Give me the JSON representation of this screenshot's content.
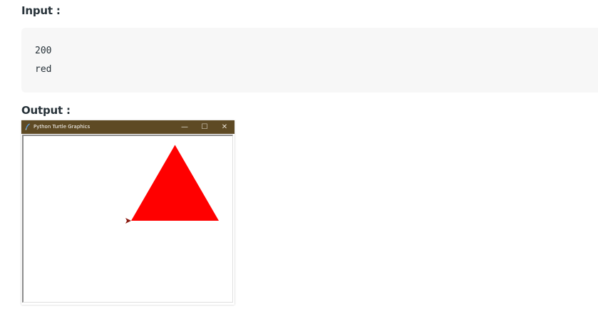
{
  "input": {
    "heading": "Input :",
    "lines": [
      "200",
      "red"
    ]
  },
  "output": {
    "heading": "Output :",
    "window": {
      "title": "Python Turtle Graphics",
      "minimize_glyph": "—",
      "maximize_glyph": "☐",
      "close_glyph": "✕",
      "titlebar_color": "#5e4a24"
    },
    "drawing": {
      "shape": "equilateral-triangle",
      "side_length": 200,
      "fill_color": "#ff0000",
      "turtle_color": "#8b1a10"
    }
  }
}
